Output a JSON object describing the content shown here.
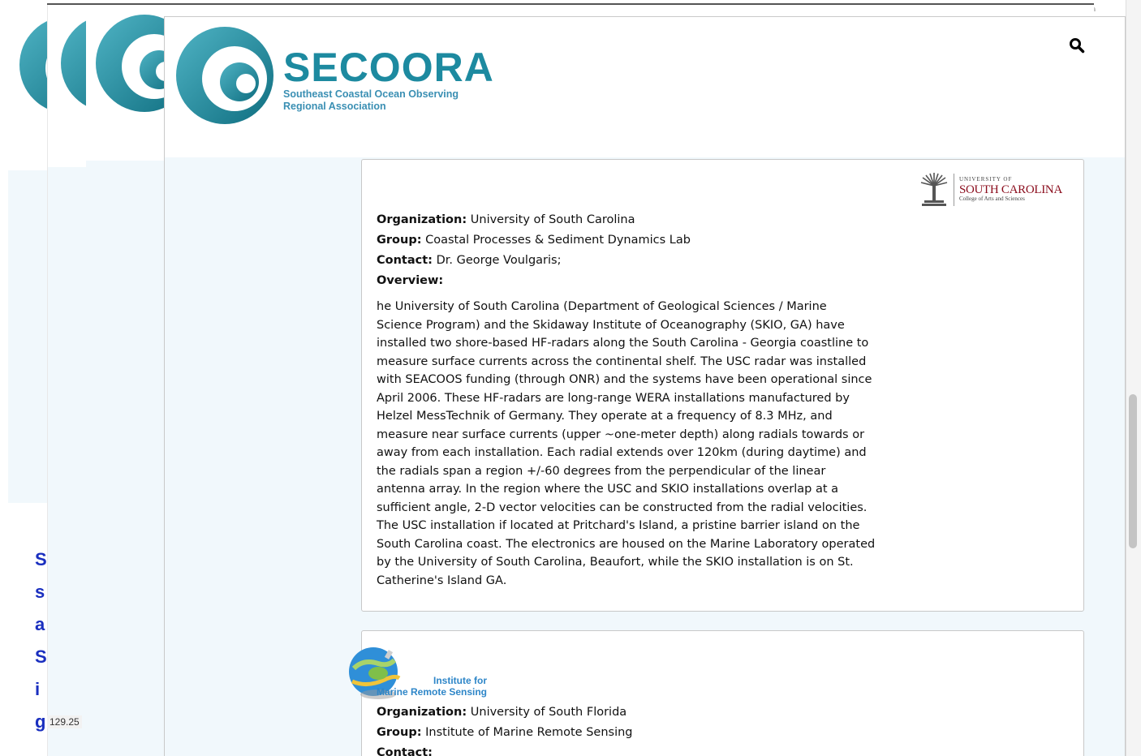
{
  "header": {
    "logo_title": "SECOORA",
    "logo_subtitle_line1": "Southeast Coastal Ocean Observing",
    "logo_subtitle_line2": "Regional Association",
    "search_icon": "search-icon"
  },
  "background": {
    "text_fragments": [
      "S",
      "s",
      "a",
      "S",
      "i",
      "g"
    ],
    "coordinate_readout": "129.25"
  },
  "labels": {
    "organization": "Organization:",
    "group": "Group:",
    "contact": "Contact:",
    "overview": "Overview:"
  },
  "cards": [
    {
      "logo": {
        "icon": "palmetto-tree-icon",
        "small_line": "UNIVERSITY OF",
        "big_line": "SOUTH CAROLINA",
        "college_line": "College of Arts and Sciences"
      },
      "organization": "University of South Carolina",
      "group": "Coastal Processes & Sediment Dynamics Lab",
      "contact": "Dr. George Voulgaris;",
      "overview": "he University of South Carolina (Department of Geological Sciences / Marine\nScience Program) and the Skidaway Institute of Oceanography (SKIO, GA) have\ninstalled two shore-based HF-radars along the South Carolina - Georgia coastline to\nmeasure surface currents across the continental shelf. The USC radar was installed\nwith SEACOOS funding (through ONR) and the systems have been operational since\nApril 2006. These HF-radars are long-range WERA installations manufactured by\nHelzel MessTechnik of Germany. They operate at a frequency of 8.3 MHz, and\nmeasure near surface currents (upper ~one-meter depth) along radials towards or\naway from each installation. Each radial extends over 120km (during daytime) and\nthe radials span a region +/-60 degrees from the perpendicular of the linear\nantenna array. In the region where the USC and SKIO installations overlap at a\nsufficient angle, 2-D vector velocities can be constructed from the radial velocities.\nThe USC installation if located at Pritchard's Island, a pristine barrier island on the\nSouth Carolina coast. The electronics are housed on the Marine Laboratory operated\nby the University of South Carolina, Beaufort, while the SKIO installation is on St.\nCatherine's Island GA."
    },
    {
      "logo": {
        "icon": "globe-satellite-icon",
        "line1": "Institute for",
        "line2": "Marine Remote Sensing"
      },
      "organization": "University of South Florida",
      "group": "Institute of Marine Remote Sensing",
      "contact": ""
    }
  ],
  "colors": {
    "brand_teal": "#1d8aa0",
    "content_background": "#f1f8fc",
    "usc_garnet": "#8b0d1d",
    "imrs_blue": "#2e86c8",
    "background_text_blue": "#1a2fbf"
  }
}
